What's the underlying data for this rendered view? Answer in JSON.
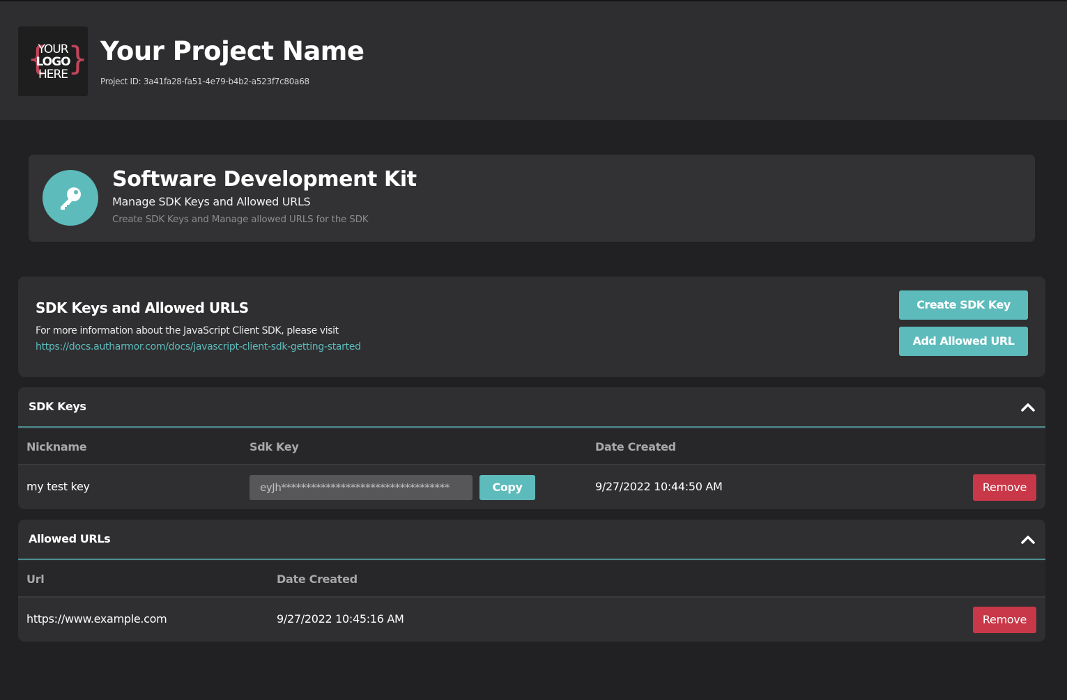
{
  "header": {
    "logo_text": [
      "YOUR",
      "LOGO",
      "HERE"
    ],
    "project_name": "Your Project Name",
    "project_id": "Project ID: 3a41fa28-fa51-4e79-b4b2-a523f7c80a68"
  },
  "sdk_card": {
    "icon": "key-icon",
    "title": "Software Development Kit",
    "subtitle": "Manage SDK Keys and Allowed URLS",
    "description": "Create SDK Keys and Manage allowed URLS for the SDK"
  },
  "info": {
    "title": "SDK Keys and Allowed URLS",
    "text": "For more information about the JavaScript Client SDK, please visit",
    "link": "https://docs.autharmor.com/docs/javascript-client-sdk-getting-started",
    "create_button": "Create SDK Key",
    "add_url_button": "Add Allowed URL"
  },
  "sdk_keys": {
    "title": "SDK Keys",
    "columns": [
      "Nickname",
      "Sdk Key",
      "Date Created"
    ],
    "rows": [
      {
        "nickname": "my test key",
        "sdk_key": "eyJh**********************************",
        "copy_label": "Copy",
        "date_created": "9/27/2022 10:44:50 AM",
        "remove_label": "Remove"
      }
    ]
  },
  "allowed_urls": {
    "title": "Allowed URLs",
    "columns": [
      "Url",
      "Date Created"
    ],
    "rows": [
      {
        "url": "https://www.example.com",
        "date_created": "9/27/2022 10:45:16 AM",
        "remove_label": "Remove"
      }
    ]
  },
  "colors": {
    "accent": "#5dbbbc",
    "danger": "#c93848",
    "background": "#212022",
    "card": "#2f2f31",
    "logo_brace": "#c2455a"
  }
}
